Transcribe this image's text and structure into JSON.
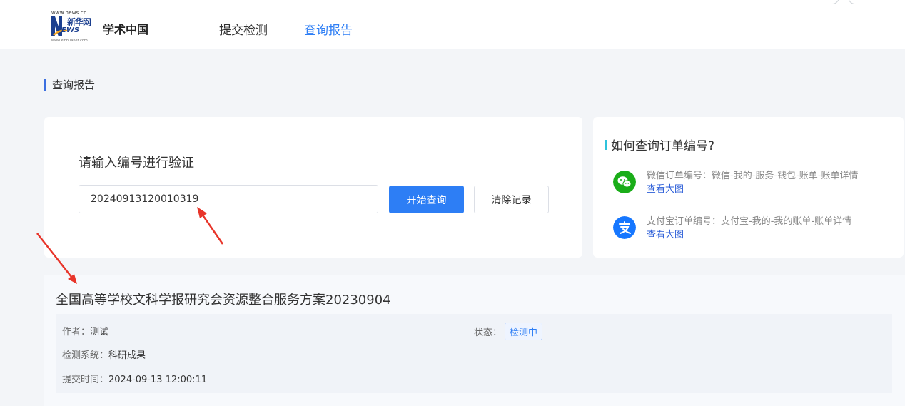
{
  "header": {
    "logo_url_text": "www.news.cn",
    "logo_mark": "新华网",
    "logo_mark_en": "EWS",
    "logo_sub_url": "www.xinhuanet.com",
    "brand": "学术中国",
    "nav": [
      {
        "label": "提交检测",
        "active": false
      },
      {
        "label": "查询报告",
        "active": true
      }
    ]
  },
  "page": {
    "section_title": "查询报告"
  },
  "query": {
    "prompt": "请输入编号进行验证",
    "input_value": "20240913120010319",
    "search_button": "开始查询",
    "clear_button": "清除记录"
  },
  "help": {
    "title": "如何查询订单编号?",
    "items": [
      {
        "icon": "wechat-icon",
        "text": "微信订单编号：微信-我的-服务-钱包-账单-账单详情",
        "link": "查看大图",
        "color": "#1aad19"
      },
      {
        "icon": "alipay-icon",
        "text": "支付宝订单编号：支付宝-我的-我的账单-账单详情",
        "link": "查看大图",
        "color": "#1677ff"
      }
    ]
  },
  "result": {
    "title": "全国高等学校文科学报研究会资源整合服务方案20230904",
    "author_label": "作者：",
    "author": "测试",
    "status_label": "状态：",
    "status": "检测中",
    "system_label": "检测系统：",
    "system": "科研成果",
    "time_label": "提交时间：",
    "time": "2024-09-13 12:00:11"
  },
  "colors": {
    "accent": "#2d7ef5",
    "annotation_arrow": "#e8352a"
  }
}
